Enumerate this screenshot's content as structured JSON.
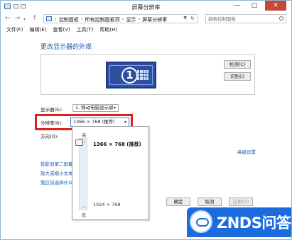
{
  "window": {
    "title": "屏幕分辨率",
    "minimize": "—",
    "maximize": "□",
    "close": "✕"
  },
  "address": {
    "back": "←",
    "forward": "→",
    "up": "↑",
    "crumbs": [
      "控制面板",
      "所有控制面板项",
      "显示",
      "屏幕分辨率"
    ],
    "separator": "›",
    "search_placeholder": "搜索控制面板"
  },
  "menu": [
    "文件(F)",
    "编辑(E)",
    "查看(V)",
    "工具(T)",
    "帮助(H)"
  ],
  "main": {
    "heading": "更改显示器的外观",
    "monitor_number": "1",
    "detect_button": "检测(C)",
    "identify_button": "识别(I)",
    "display_label": "显示器(S):",
    "display_value": "1. 移动电脑显示屏",
    "resolution_label": "分辨率(R):",
    "resolution_value": "1366 × 768 (推荐)",
    "orientation_label": "方向(O):",
    "advanced_link": "高级设置",
    "links": [
      "投影到第二屏幕",
      "放大或缩小文本",
      "我应该选择什么"
    ]
  },
  "resolution_popup": {
    "high_label": "高",
    "low_label": "低",
    "max_option": "1366 × 768 (推荐)",
    "min_option": "1024 × 768",
    "selected_level": 1.0
  },
  "footer": {
    "ok": "确定",
    "cancel": "取消",
    "apply": "应用(A)"
  },
  "watermark": {
    "text": "ZNDS问答"
  },
  "colors": {
    "accent_link": "#1e5aa8",
    "highlight_frame": "#e02020",
    "monitor_blue": "#2e4fa0",
    "watermark_blue": "#1c6cde"
  }
}
